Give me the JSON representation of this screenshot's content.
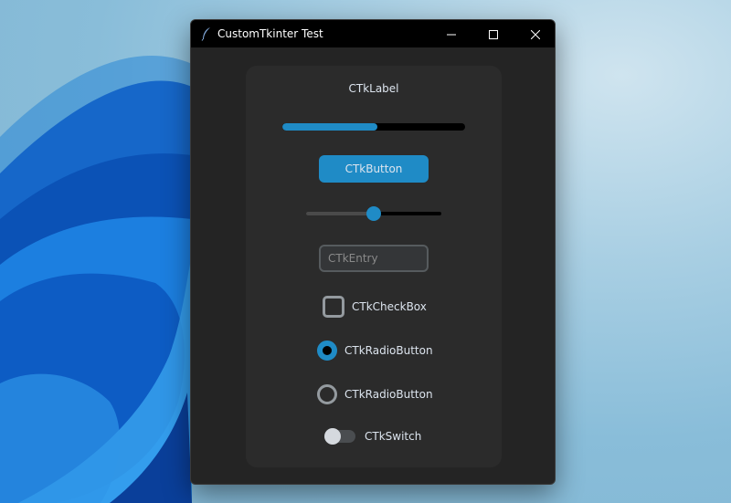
{
  "window": {
    "title": "CustomTkinter Test"
  },
  "colors": {
    "accent": "#1f8bc6",
    "window_bg": "#242424",
    "frame_bg": "#2b2b2b",
    "text": "#dce4ee"
  },
  "icons": {
    "app": "feather-icon",
    "minimize": "minimize-icon",
    "maximize": "maximize-icon",
    "close": "close-icon"
  },
  "widgets": {
    "label": "CTkLabel",
    "progress_value": 0.52,
    "button_label": "CTkButton",
    "slider_value": 0.5,
    "entry_placeholder": "CTkEntry",
    "entry_value": "",
    "checkbox_label": "CTkCheckBox",
    "checkbox_checked": false,
    "radio_1_label": "CTkRadioButton",
    "radio_1_selected": true,
    "radio_2_label": "CTkRadioButton",
    "radio_2_selected": false,
    "switch_label": "CTkSwitch",
    "switch_on": false
  }
}
